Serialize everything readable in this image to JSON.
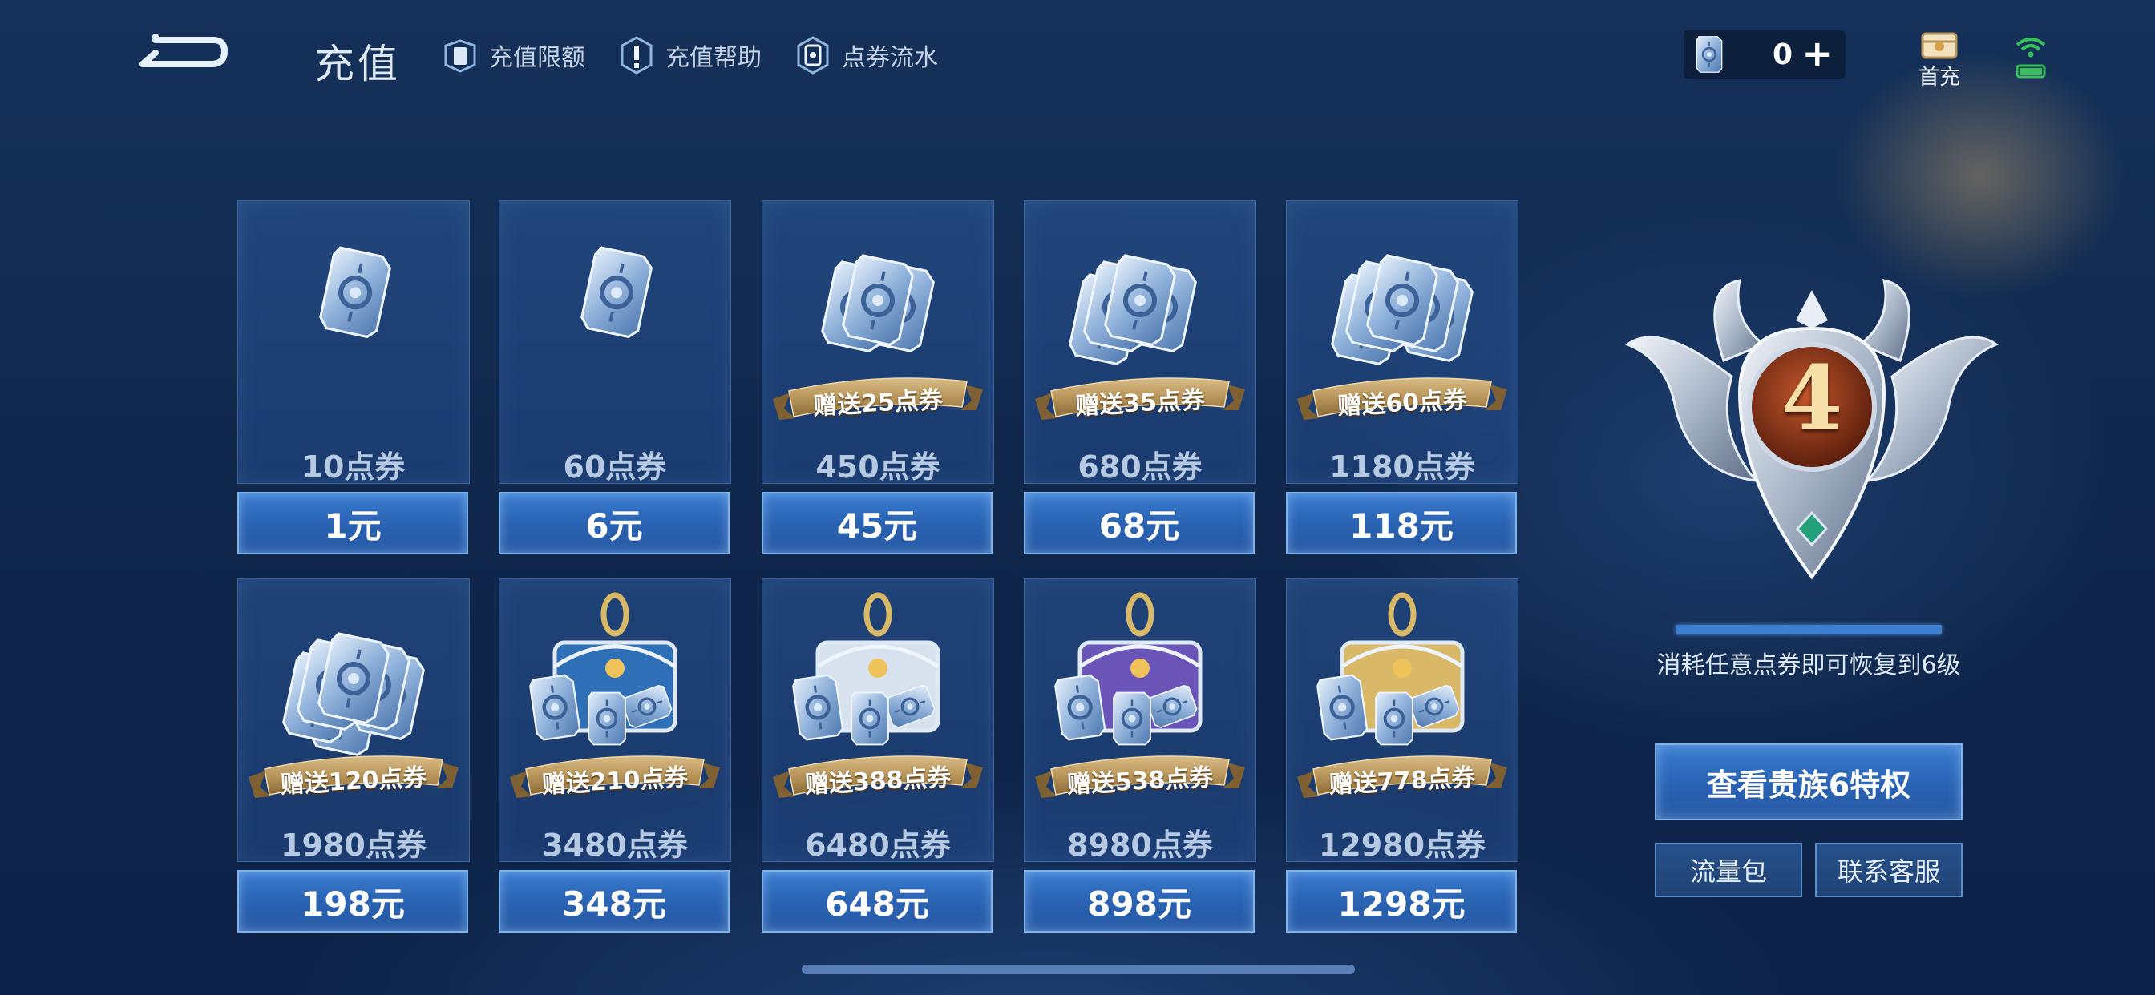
{
  "header": {
    "title": "充值",
    "links": [
      {
        "label": "充值限额",
        "icon": "ticket-card-icon"
      },
      {
        "label": "充值帮助",
        "icon": "exclamation-icon"
      },
      {
        "label": "点券流水",
        "icon": "coin-flow-icon"
      }
    ],
    "balance": "0",
    "balance_plus": "+",
    "first_charge_label": "首充"
  },
  "products": [
    {
      "tickets": "10点券",
      "price": "1元",
      "bonus": ""
    },
    {
      "tickets": "60点券",
      "price": "6元",
      "bonus": ""
    },
    {
      "tickets": "450点券",
      "price": "45元",
      "bonus": "赠送25点券"
    },
    {
      "tickets": "680点券",
      "price": "68元",
      "bonus": "赠送35点券"
    },
    {
      "tickets": "1180点券",
      "price": "118元",
      "bonus": "赠送60点券"
    },
    {
      "tickets": "1980点券",
      "price": "198元",
      "bonus": "赠送120点券"
    },
    {
      "tickets": "3480点券",
      "price": "348元",
      "bonus": "赠送210点券"
    },
    {
      "tickets": "6480点券",
      "price": "648元",
      "bonus": "赠送388点券"
    },
    {
      "tickets": "8980点券",
      "price": "898元",
      "bonus": "赠送538点券"
    },
    {
      "tickets": "12980点券",
      "price": "1298元",
      "bonus": "赠送778点券"
    }
  ],
  "noble": {
    "level": "4",
    "progress": 1.0,
    "tip": "消耗任意点券即可恢复到6级",
    "view_button": "查看贵族6特权",
    "data_pack_button": "流量包",
    "service_button": "联系客服"
  },
  "colors": {
    "accent_blue": "#2a63b3",
    "ribbon_gold": "#b8955a",
    "emblem_red": "#8a3318"
  }
}
